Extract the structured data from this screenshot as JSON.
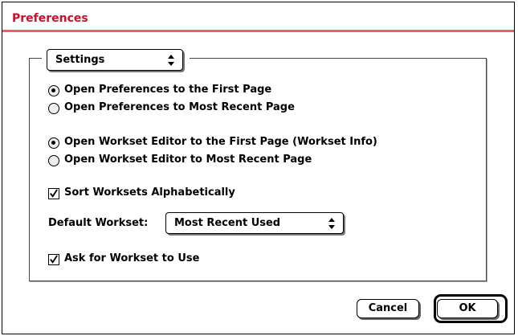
{
  "window": {
    "title": "Preferences",
    "accent_color": "#c8102e"
  },
  "section_popup": {
    "label": "Settings",
    "icon": "up-down-arrows-icon"
  },
  "preferences_page": [
    {
      "label": "Open Preferences to the First Page",
      "selected": true
    },
    {
      "label": "Open Preferences to Most Recent Page",
      "selected": false
    }
  ],
  "workset_editor_page": [
    {
      "label": "Open Workset Editor to the First Page (Workset Info)",
      "selected": true
    },
    {
      "label": "Open Workset Editor to Most Recent Page",
      "selected": false
    }
  ],
  "sort_worksets": {
    "label": "Sort Worksets Alphabetically",
    "checked": true
  },
  "default_workset": {
    "label": "Default Workset:",
    "value": "Most Recent Used"
  },
  "ask_workset": {
    "label": "Ask for Workset to Use",
    "checked": true
  },
  "buttons": {
    "cancel": "Cancel",
    "ok": "OK"
  }
}
